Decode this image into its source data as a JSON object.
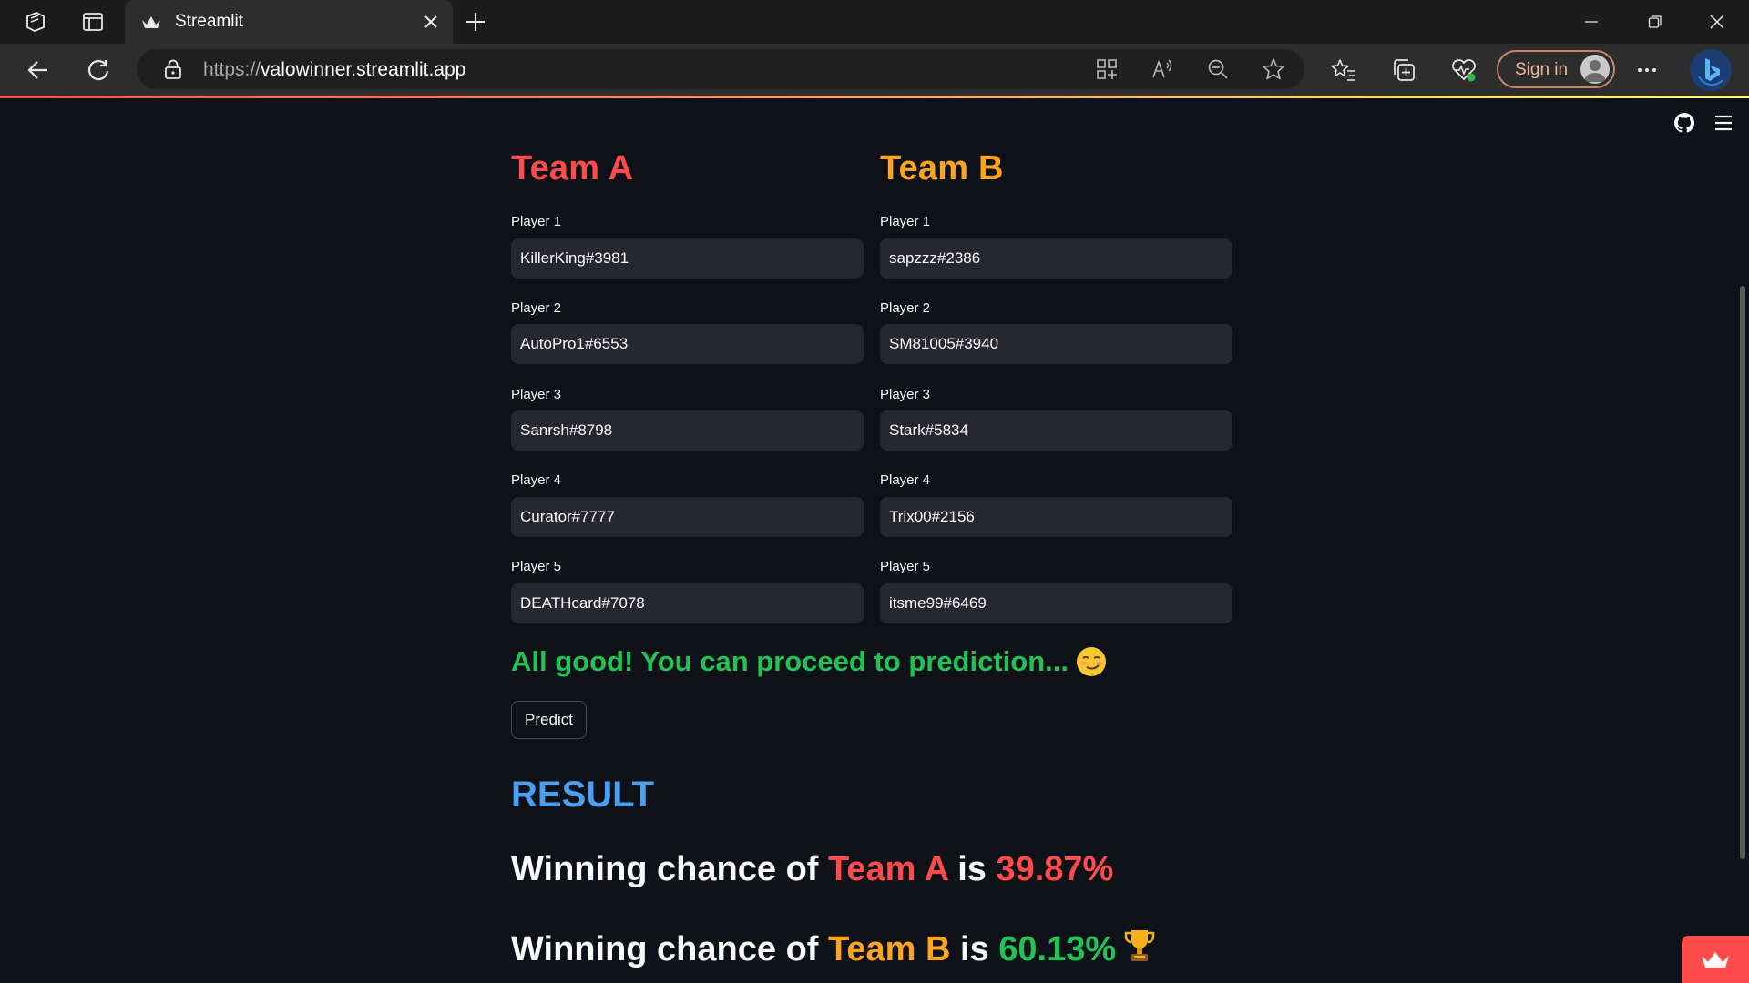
{
  "browser": {
    "tab_title": "Streamlit",
    "url_protocol": "https://",
    "url_host": "valowinner.streamlit.app",
    "sign_in_label": "Sign in"
  },
  "app": {
    "team_a": {
      "heading": "Team A",
      "color": "#ff4b4b",
      "players": [
        {
          "label": "Player 1",
          "value": "KillerKing#3981"
        },
        {
          "label": "Player 2",
          "value": "AutoPro1#6553"
        },
        {
          "label": "Player 3",
          "value": "Sanrsh#8798"
        },
        {
          "label": "Player 4",
          "value": "Curator#7777"
        },
        {
          "label": "Player 5",
          "value": "DEATHcard#7078"
        }
      ]
    },
    "team_b": {
      "heading": "Team B",
      "color": "#ffa421",
      "players": [
        {
          "label": "Player 1",
          "value": "sapzzz#2386"
        },
        {
          "label": "Player 2",
          "value": "SM81005#3940"
        },
        {
          "label": "Player 3",
          "value": "Stark#5834"
        },
        {
          "label": "Player 4",
          "value": "Trix00#2156"
        },
        {
          "label": "Player 5",
          "value": "itsme99#6469"
        }
      ]
    },
    "status_message": "All good! You can proceed to prediction...",
    "status_emoji": "smirking-face",
    "predict_label": "Predict",
    "result_heading": "RESULT",
    "result_a": {
      "prefix": "Winning chance of ",
      "team": "Team A",
      "mid": " is ",
      "pct": "39.87%"
    },
    "result_b": {
      "prefix": "Winning chance of ",
      "team": "Team B",
      "mid": " is ",
      "pct": "60.13%",
      "icon": "trophy"
    }
  },
  "colors": {
    "background": "#0e1117",
    "input_bg": "#262730",
    "success": "#21c354",
    "result_heading": "#4aa0f0"
  }
}
